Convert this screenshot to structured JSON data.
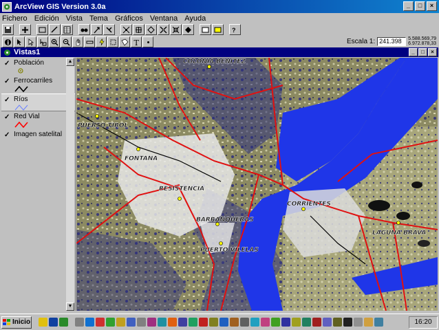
{
  "window": {
    "title": "ArcView GIS Version 3.0a"
  },
  "menu": [
    "Fichero",
    "Edición",
    "Vista",
    "Tema",
    "Gráficos",
    "Ventana",
    "Ayuda"
  ],
  "scale": {
    "label": "Escala 1:",
    "value": "241.398",
    "coord_x": "5.588.569,79",
    "coord_y": "6.972.878,33"
  },
  "view": {
    "title": "Vistas1"
  },
  "toc": [
    {
      "label": "Población",
      "symbol": "point",
      "color": "#808000"
    },
    {
      "label": "Ferrocarriles",
      "symbol": "line",
      "color": "#000000"
    },
    {
      "label": "Ríos",
      "symbol": "line",
      "color": "#6a80ff"
    },
    {
      "label": "Red Vial",
      "symbol": "line",
      "color": "#ff0000"
    },
    {
      "label": "Imagen satelital",
      "symbol": "none",
      "color": ""
    }
  ],
  "map_labels": {
    "colonia_benitez": "COLONIA BENITEZ",
    "puerto_tirol": "PUERTO TIROL",
    "fontana": "FONTANA",
    "resistencia": "RESISTENCIA",
    "barranqueras": "BARRANQUERAS",
    "puerto_vilelas": "PUERTO VILELAS",
    "corrientes": "CORRIENTES",
    "laguna_brava": "LAGUNA BRAVA"
  },
  "taskbar": {
    "start": "Inicio",
    "clock": "16:20"
  },
  "colors": {
    "titlebar": "#000080",
    "river": "#1f36e8",
    "road": "#e01010",
    "city": "#e8e8e8"
  }
}
